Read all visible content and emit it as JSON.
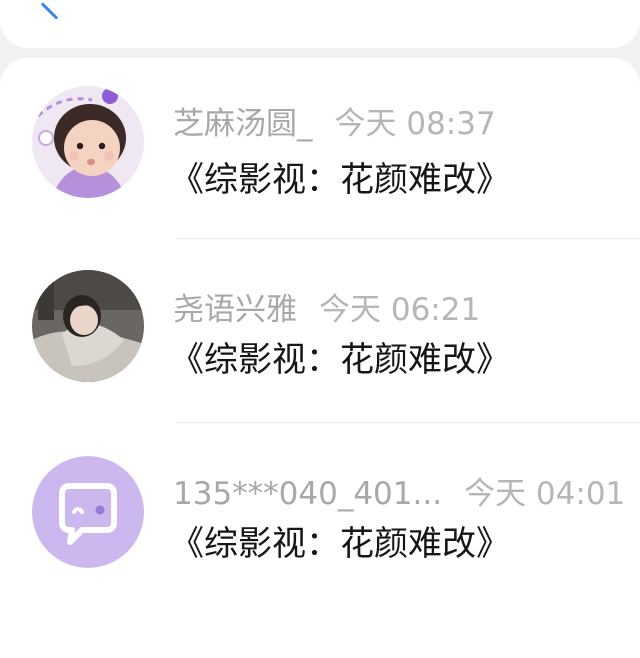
{
  "conversations": [
    {
      "name": "芝麻汤圆_",
      "time": "今天 08:37",
      "message": "《综影视：花颜难改》",
      "avatar": "photo-avatar-child"
    },
    {
      "name": "尧语兴雅",
      "time": "今天 06:21",
      "message": "《综影视：花颜难改》",
      "avatar": "photo-avatar-woman"
    },
    {
      "name": "135***040_401...",
      "time": "今天 04:01",
      "message": "《综影视：花颜难改》",
      "avatar": "default-chat-bubble-avatar"
    }
  ],
  "colors": {
    "accent": "#3a86f0",
    "default_avatar_bg": "#cdb7ef"
  }
}
